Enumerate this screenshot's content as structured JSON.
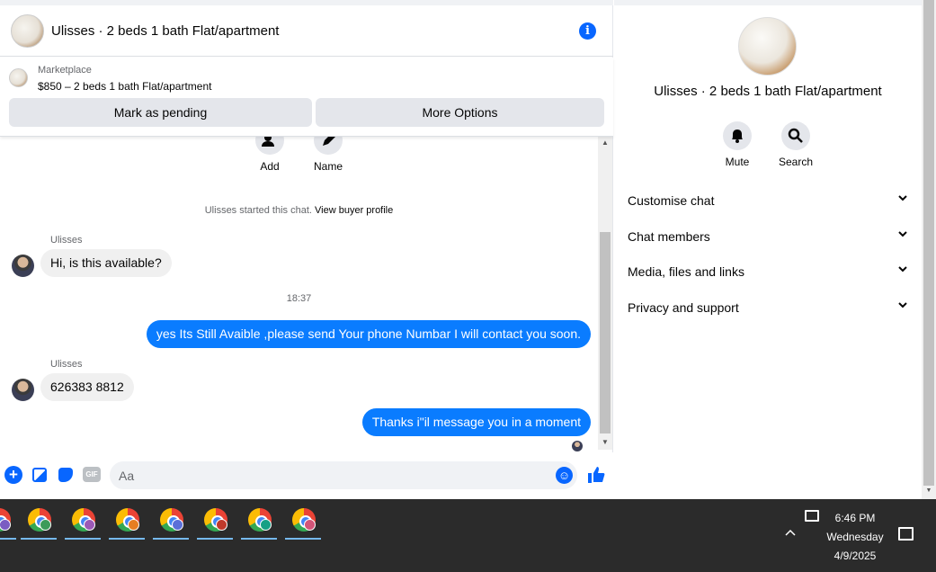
{
  "chat": {
    "title": "Ulisses · 2 beds 1 bath Flat/apartment",
    "info_icon": "info-icon",
    "listing": {
      "source": "Marketplace",
      "price_title": "$850 – 2 beds 1 bath Flat/apartment",
      "mark_pending_label": "Mark as pending",
      "more_options_label": "More Options"
    },
    "actions": {
      "add_label": "Add",
      "name_label": "Name"
    },
    "started_text": "Ulisses started this chat.",
    "buyer_profile_link": "View buyer profile",
    "messages": [
      {
        "sender": "Ulisses",
        "text": "Hi, is this available?"
      },
      {
        "time": "18:37"
      },
      {
        "text": "yes Its Still Avaible ,please send Your phone Numbar I will contact you soon."
      },
      {
        "sender": "Ulisses",
        "text": "626383 8812"
      },
      {
        "text": "Thanks i\"il message you in a moment"
      }
    ],
    "composer": {
      "placeholder": "Aa",
      "gif_label": "GIF"
    }
  },
  "side": {
    "title": "Ulisses · 2 beds 1 bath Flat/apartment",
    "mute_label": "Mute",
    "search_label": "Search",
    "sections": [
      "Customise chat",
      "Chat members",
      "Media, files and links",
      "Privacy and support"
    ]
  },
  "taskbar": {
    "time": "6:46 PM",
    "day": "Wednesday",
    "date": "4/9/2025"
  },
  "colors": {
    "accent": "#0866ff",
    "bubble_out": "#0a7cff",
    "bubble_in": "#f0f0f0",
    "taskbar": "#2b2b2b"
  }
}
